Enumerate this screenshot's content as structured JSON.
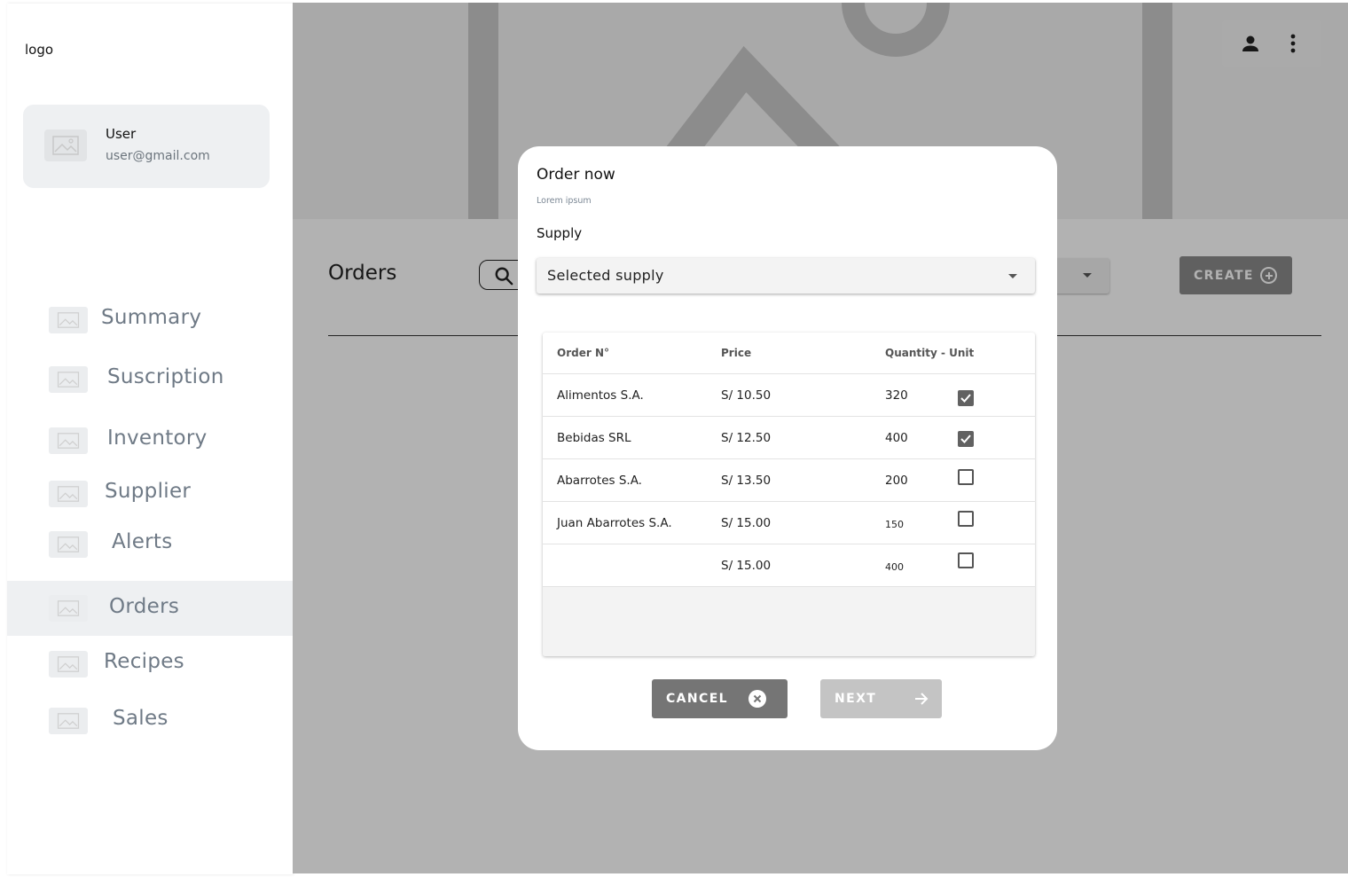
{
  "sidebar": {
    "logo": "logo",
    "user": {
      "name": "User",
      "email": "user@gmail.com"
    },
    "items": [
      {
        "label": "Summary",
        "icon": "image-placeholder-icon"
      },
      {
        "label": "Suscription",
        "icon": "image-placeholder-icon"
      },
      {
        "label": "Inventory",
        "icon": "image-placeholder-icon"
      },
      {
        "label": "Supplier",
        "icon": "image-placeholder-icon"
      },
      {
        "label": "Alerts",
        "icon": "image-placeholder-icon"
      },
      {
        "label": "Orders",
        "icon": "image-placeholder-icon",
        "active": true
      },
      {
        "label": "Recipes",
        "icon": "image-placeholder-icon"
      },
      {
        "label": "Sales",
        "icon": "image-placeholder-icon"
      }
    ]
  },
  "main": {
    "title": "Orders",
    "create_label": "CREATE"
  },
  "modal": {
    "title": "Order now",
    "subtitle": "Lorem ipsum",
    "supply_label": "Supply",
    "supply_value": "Selected supply",
    "table": {
      "headers": [
        "Order N°",
        "Price",
        "Quantity - Unit"
      ],
      "rows": [
        {
          "name": "Alimentos S.A.",
          "price": "S/ 10.50",
          "qty": "320",
          "checked": true
        },
        {
          "name": "Bebidas SRL",
          "price": "S/ 12.50",
          "qty": "400",
          "checked": true
        },
        {
          "name": "Abarrotes S.A.",
          "price": "S/ 13.50",
          "qty": "200",
          "checked": false
        },
        {
          "name": "Juan Abarrotes S.A.",
          "price": "S/ 15.00",
          "qty": "150",
          "checked": false
        },
        {
          "name": "",
          "price": "S/ 15.00",
          "qty": "400",
          "checked": false
        }
      ]
    },
    "cancel_label": "CANCEL",
    "next_label": "NEXT"
  },
  "colors": {
    "overlay": "#000000",
    "sidebar_active": "#eef0f2",
    "nav_text": "#6f7a86",
    "cancel_button": "#757575",
    "next_button_disabled": "#c4c4c4",
    "checkbox_checked": "#616161"
  }
}
